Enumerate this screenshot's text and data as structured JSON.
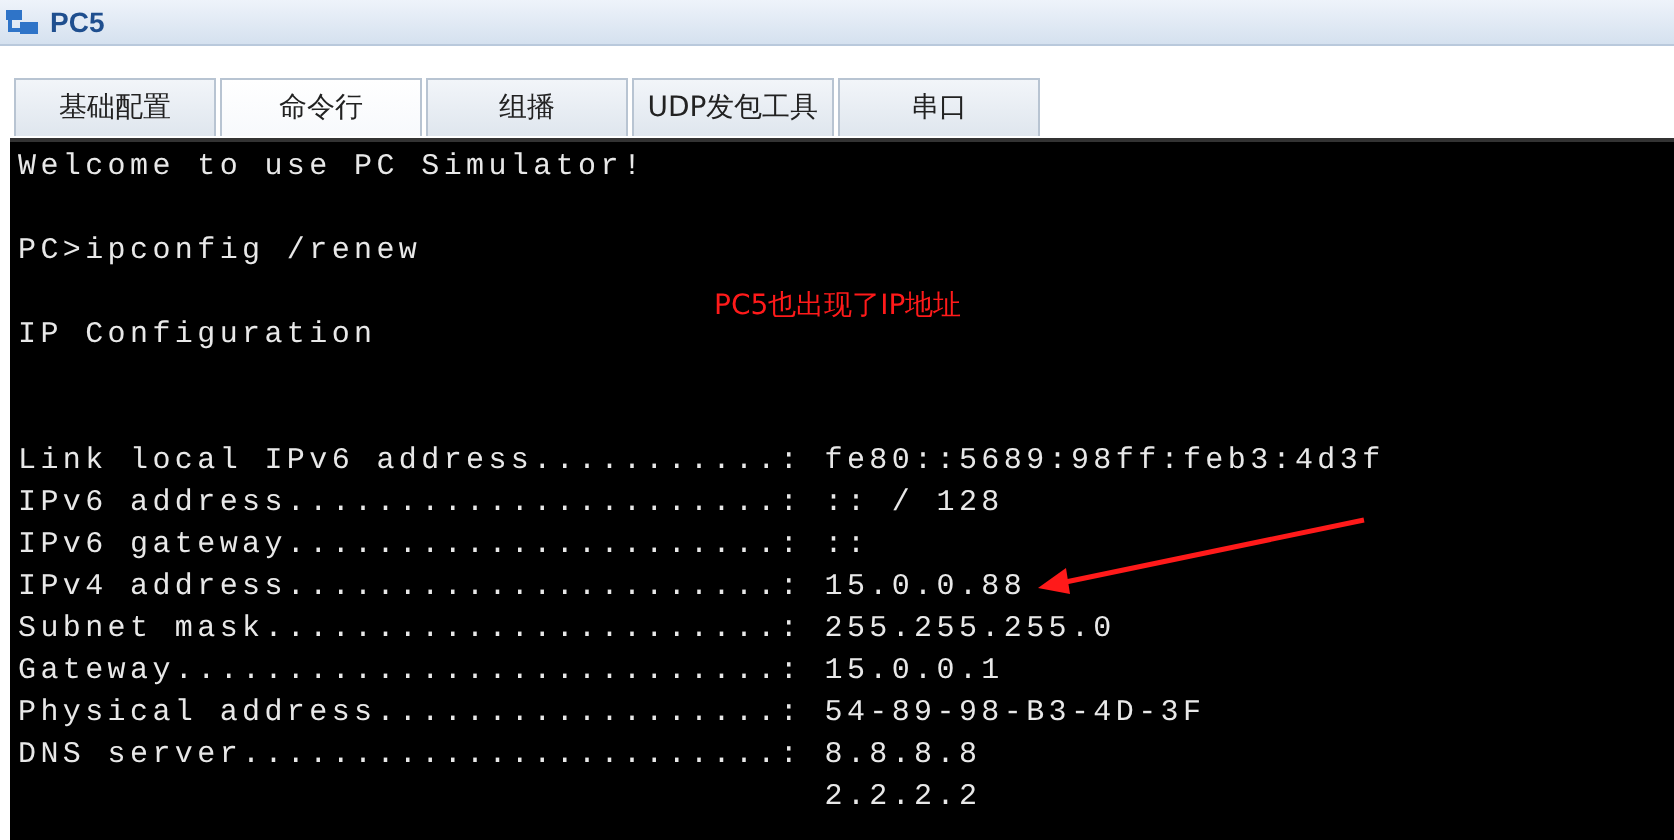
{
  "window": {
    "title": "PC5"
  },
  "tabs": [
    {
      "label": "基础配置",
      "selected": false
    },
    {
      "label": "命令行",
      "selected": true
    },
    {
      "label": "组播",
      "selected": false
    },
    {
      "label": "UDP发包工具",
      "selected": false
    },
    {
      "label": "串口",
      "selected": false
    }
  ],
  "terminal": {
    "lines": [
      {
        "kind": "text",
        "text": "Welcome to use PC Simulator!"
      },
      {
        "kind": "blank"
      },
      {
        "kind": "text",
        "text": "PC>ipconfig /renew"
      },
      {
        "kind": "blank"
      },
      {
        "kind": "text",
        "text": "IP Configuration"
      },
      {
        "kind": "blank"
      },
      {
        "kind": "blank"
      },
      {
        "kind": "text",
        "text": "Link local IPv6 address...........: fe80::5689:98ff:feb3:4d3f"
      },
      {
        "kind": "text",
        "text": "IPv6 address......................: :: / 128"
      },
      {
        "kind": "text",
        "text": "IPv6 gateway......................: ::"
      },
      {
        "kind": "text",
        "text": "IPv4 address......................: 15.0.0.88"
      },
      {
        "kind": "text",
        "text": "Subnet mask.......................: 255.255.255.0"
      },
      {
        "kind": "text",
        "text": "Gateway...........................: 15.0.0.1"
      },
      {
        "kind": "text",
        "text": "Physical address..................: 54-89-98-B3-4D-3F"
      },
      {
        "kind": "text",
        "text": "DNS server........................: 8.8.8.8"
      },
      {
        "kind": "text",
        "text": "                                    2.2.2.2"
      }
    ]
  },
  "annotation": {
    "text": "PC5也出现了IP地址"
  }
}
